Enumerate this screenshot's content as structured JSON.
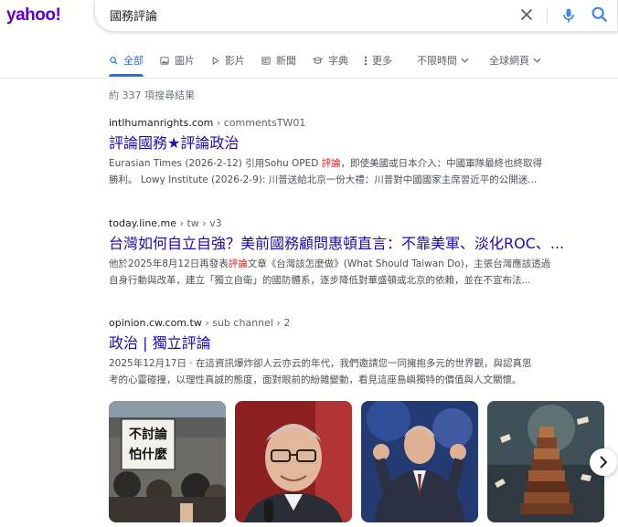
{
  "brand": {
    "logo_text": "yahoo!",
    "logo_color": "#6001d2"
  },
  "search": {
    "query": "國務評論"
  },
  "icons": {
    "clear": "close-icon",
    "mic": "microphone-icon",
    "search": "search-icon"
  },
  "tabs": [
    {
      "label": "全部",
      "icon": "search-icon",
      "active": true
    },
    {
      "label": "圖片",
      "icon": "image-icon"
    },
    {
      "label": "影片",
      "icon": "play-icon"
    },
    {
      "label": "新聞",
      "icon": "news-icon"
    },
    {
      "label": "字典",
      "icon": "dictionary-icon"
    },
    {
      "label": "更多",
      "icon": "more-vert-icon"
    },
    {
      "label": "不限時間",
      "dropdown": true
    },
    {
      "label": "全球網頁",
      "dropdown": true
    }
  ],
  "result_stats": "約 337 項搜尋結果",
  "results": [
    {
      "domain": "intlhumanrights.com",
      "path": " › commentsTW01",
      "title": "評論國務★評論政治",
      "snippet_lines": [
        {
          "pre": "Eurasian Times (2026-2-12) 引用Sohu OPED ",
          "em": "評論",
          "post": "，即使美國或日本介入：中國軍隊最終也終取得"
        },
        {
          "pre": "勝利。 Lowy Institute (2026-2-9): 川普送給北京一份大禮：川普對中國國家主席習近平的公開迷...",
          "em": "",
          "post": ""
        }
      ]
    },
    {
      "domain": "today.line.me",
      "path": " › tw › v3",
      "title": "台灣如何自立自強？美前國務顧問惠頓直言：不靠美軍、淡化ROC、...",
      "snippet_lines": [
        {
          "pre": "他於2025年8月12日再發表",
          "em": "評論",
          "post": "文章《台灣該怎麼做》(What Should Taiwan Do)，主張台灣應該透過"
        },
        {
          "pre": "自身行動與改革，建立「獨立自衛」的國防體系，逐步降低對華盛頓或北京的依賴，並在不宣布法...",
          "em": "",
          "post": ""
        }
      ]
    },
    {
      "domain": "opinion.cw.com.tw",
      "path": " › sub channel › 2",
      "title": "政治 | 獨立評論",
      "snippet_lines": [
        {
          "pre": "2025年12月17日 · 在這資訊爆炸卻人云亦云的年代，我們邀請您一同擁抱多元的世界觀，與認真思",
          "em": "",
          "post": ""
        },
        {
          "pre": "考的心靈碰撞，以理性真誠的態度，面對眼前的紛雜變動，看見這座島嶼獨特的價值與人文關懷。",
          "em": "",
          "post": ""
        }
      ]
    }
  ],
  "images": [
    {
      "name": "protest-photo",
      "sign_text": [
        "不討論",
        "怕什麼"
      ]
    },
    {
      "name": "speaker-portrait-photo"
    },
    {
      "name": "speaker-gesture-photo"
    },
    {
      "name": "books-illustration"
    }
  ],
  "next_icon": "chevron-right-icon"
}
